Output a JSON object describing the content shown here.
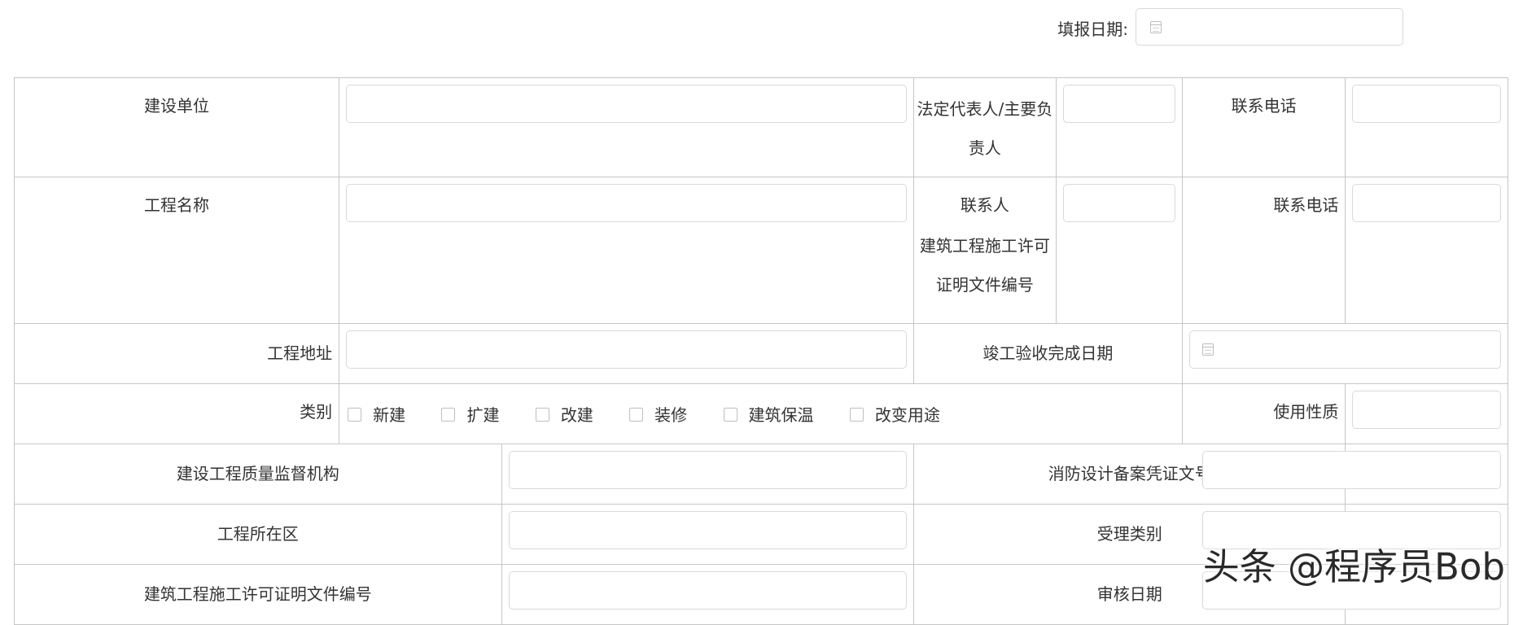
{
  "header": {
    "date_label": "填报日期:",
    "date_value": ""
  },
  "rows": {
    "r1": {
      "label": "建设单位",
      "legal_rep_label": "法定代表人/主要负责人",
      "phone_label": "联系电话"
    },
    "r2": {
      "label": "工程名称",
      "contact_label": "联系人",
      "permit_label": "建筑工程施工许可证明文件编号",
      "phone_label": "联系电话"
    },
    "r3": {
      "label": "工程地址",
      "completion_label": "竣工验收完成日期"
    },
    "r4": {
      "label": "类别",
      "options": [
        "新建",
        "扩建",
        "改建",
        "装修",
        "建筑保温",
        "改变用途"
      ],
      "usage_label": "使用性质"
    },
    "r5": {
      "label": "建设工程质量监督机构",
      "fire_label": "消防设计备案凭证文号"
    },
    "r6": {
      "label": "工程所在区",
      "accept_label": "受理类别"
    },
    "r7": {
      "label": "建筑工程施工许可证明文件编号",
      "audit_label": "审核日期"
    }
  },
  "watermark": "头条 @程序员Bob",
  "icons": {
    "date": "calendar-icon",
    "checkbox": "checkbox-unchecked-icon"
  },
  "colors": {
    "border": "#c6c6c6",
    "input_border": "#d9d9d9",
    "text": "#333333"
  }
}
